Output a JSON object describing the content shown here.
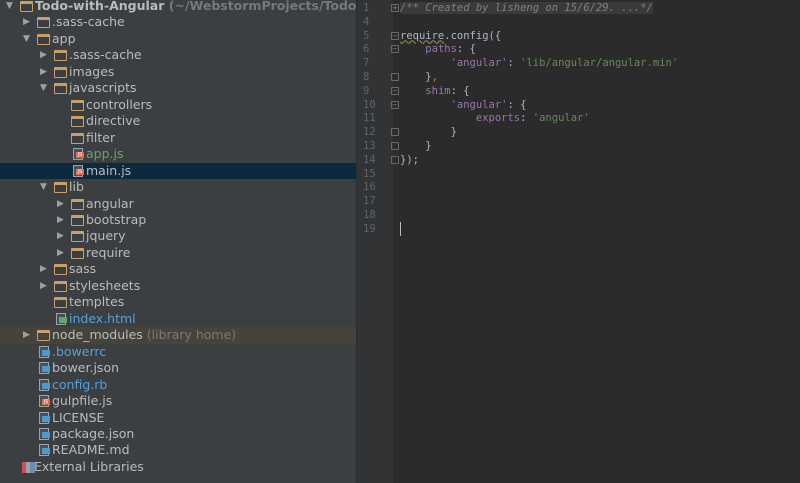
{
  "project_tree": [
    {
      "name": "Todo-with-Angular",
      "hint": "(~/WebstormProjects/Todo-with",
      "level": 0,
      "arrow": "open",
      "icon": "folder",
      "bold": true
    },
    {
      "name": ".sass-cache",
      "level": 1,
      "arrow": "closed",
      "icon": "folder"
    },
    {
      "name": "app",
      "level": 1,
      "arrow": "open",
      "icon": "folder"
    },
    {
      "name": ".sass-cache",
      "level": 2,
      "arrow": "closed",
      "icon": "folder"
    },
    {
      "name": "images",
      "level": 2,
      "arrow": "closed",
      "icon": "folder"
    },
    {
      "name": "javascripts",
      "level": 2,
      "arrow": "open",
      "icon": "folder"
    },
    {
      "name": "controllers",
      "level": 3,
      "arrow": "none",
      "icon": "folder"
    },
    {
      "name": "directive",
      "level": 3,
      "arrow": "none",
      "icon": "folder"
    },
    {
      "name": "filter",
      "level": 3,
      "arrow": "none",
      "icon": "folder"
    },
    {
      "name": "app.js",
      "level": 3,
      "arrow": "none",
      "icon": "js",
      "color": "#62a66b"
    },
    {
      "name": "main.js",
      "level": 3,
      "arrow": "none",
      "icon": "js",
      "selected": true
    },
    {
      "name": "lib",
      "level": 2,
      "arrow": "open",
      "icon": "folder"
    },
    {
      "name": "angular",
      "level": 3,
      "arrow": "closed",
      "icon": "folder"
    },
    {
      "name": "bootstrap",
      "level": 3,
      "arrow": "closed",
      "icon": "folder"
    },
    {
      "name": "jquery",
      "level": 3,
      "arrow": "closed",
      "icon": "folder"
    },
    {
      "name": "require",
      "level": 3,
      "arrow": "closed",
      "icon": "folder"
    },
    {
      "name": "sass",
      "level": 2,
      "arrow": "closed",
      "icon": "folder"
    },
    {
      "name": "stylesheets",
      "level": 2,
      "arrow": "closed",
      "icon": "folder"
    },
    {
      "name": "templtes",
      "level": 2,
      "arrow": "none",
      "icon": "folder"
    },
    {
      "name": "index.html",
      "level": 2,
      "arrow": "none",
      "icon": "html",
      "color": "#5a9fd4"
    },
    {
      "name": "node_modules",
      "hint": "(library home)",
      "level": 1,
      "arrow": "closed",
      "icon": "folder",
      "library": true
    },
    {
      "name": ".bowerrc",
      "level": 1,
      "arrow": "none",
      "icon": "json",
      "color": "#5a9fd4"
    },
    {
      "name": "bower.json",
      "level": 1,
      "arrow": "none",
      "icon": "json"
    },
    {
      "name": "config.rb",
      "level": 1,
      "arrow": "none",
      "icon": "text",
      "color": "#5a9fd4"
    },
    {
      "name": "gulpfile.js",
      "level": 1,
      "arrow": "none",
      "icon": "js"
    },
    {
      "name": "LICENSE",
      "level": 1,
      "arrow": "none",
      "icon": "text"
    },
    {
      "name": "package.json",
      "level": 1,
      "arrow": "none",
      "icon": "json"
    },
    {
      "name": "README.md",
      "level": 1,
      "arrow": "none",
      "icon": "text"
    },
    {
      "name": "External Libraries",
      "level": 0,
      "arrow": "none",
      "icon": "libraries",
      "ext": true
    }
  ],
  "editor": {
    "lines": [
      {
        "n": "1",
        "fold": "+",
        "html": "<span class='cm'>/** Created by lisheng on 15/6/29. ...*/</span>"
      },
      {
        "n": "4",
        "fold": "",
        "html": ""
      },
      {
        "n": "5",
        "fold": "-",
        "html": "<span class='wavy'>require</span>.config({"
      },
      {
        "n": "6",
        "fold": "-",
        "html": "    <span class='prop'>paths</span>: {"
      },
      {
        "n": "7",
        "fold": "",
        "html": "        <span class='prop'>'angular'</span>: <span class='str'>'lib/angular/angular.min'</span>"
      },
      {
        "n": "8",
        "fold": "^",
        "html": "    }<span class='pun'>,</span>"
      },
      {
        "n": "9",
        "fold": "-",
        "html": "    <span class='prop'>shim</span>: {"
      },
      {
        "n": "10",
        "fold": "-",
        "html": "        <span class='prop'>'angular'</span>: {"
      },
      {
        "n": "11",
        "fold": "",
        "html": "            <span class='prop'>exports</span>: <span class='str'>'angular'</span>"
      },
      {
        "n": "12",
        "fold": "^",
        "html": "        }"
      },
      {
        "n": "13",
        "fold": "^",
        "html": "    }"
      },
      {
        "n": "14",
        "fold": "^",
        "html": "});"
      },
      {
        "n": "15",
        "fold": "",
        "html": ""
      },
      {
        "n": "16",
        "fold": "",
        "html": ""
      },
      {
        "n": "17",
        "fold": "",
        "html": ""
      },
      {
        "n": "18",
        "fold": "",
        "html": ""
      },
      {
        "n": "19",
        "fold": "",
        "html": ""
      }
    ]
  }
}
